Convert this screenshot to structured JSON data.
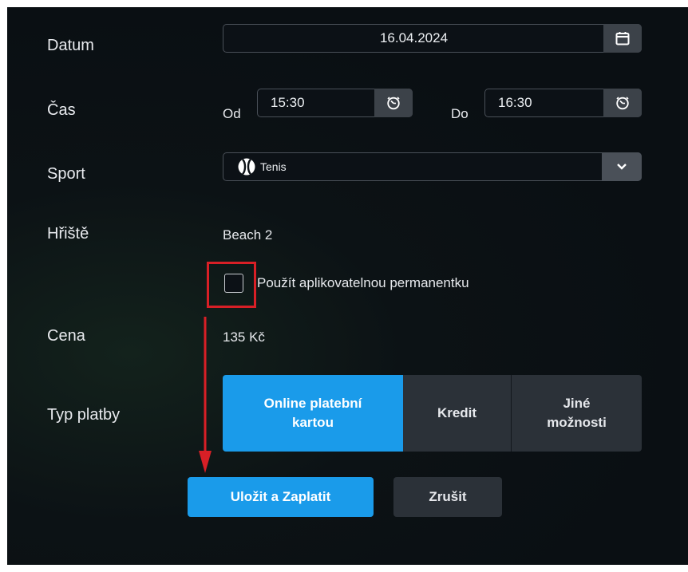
{
  "form": {
    "date": {
      "label": "Datum",
      "value": "16.04.2024",
      "icon": "calendar-icon"
    },
    "time": {
      "label": "Čas",
      "from_label": "Od",
      "from_value": "15:30",
      "to_label": "Do",
      "to_value": "16:30",
      "icon": "clock-icon"
    },
    "sport": {
      "label": "Sport",
      "value": "Tenis",
      "icon": "tennis-ball-icon"
    },
    "court": {
      "label": "Hřiště",
      "value": "Beach 2"
    },
    "pass_checkbox": {
      "label": "Použít aplikovatelnou permanentku",
      "checked": false
    },
    "price": {
      "label": "Cena",
      "value": "135 Kč"
    },
    "payment": {
      "label": "Typ platby",
      "options": [
        {
          "line1": "Online platební",
          "line2": "kartou",
          "selected": true
        },
        {
          "line1": "Kredit",
          "selected": false
        },
        {
          "line1": "Jiné",
          "line2": "možnosti",
          "selected": false
        }
      ]
    }
  },
  "actions": {
    "save_label": "Uložit a Zaplatit",
    "cancel_label": "Zrušit"
  },
  "annotations": {
    "highlight_color": "#d81f26"
  },
  "colors": {
    "accent": "#1a9bea",
    "background": "#0a0f13",
    "secondary_button": "#2b3138"
  }
}
